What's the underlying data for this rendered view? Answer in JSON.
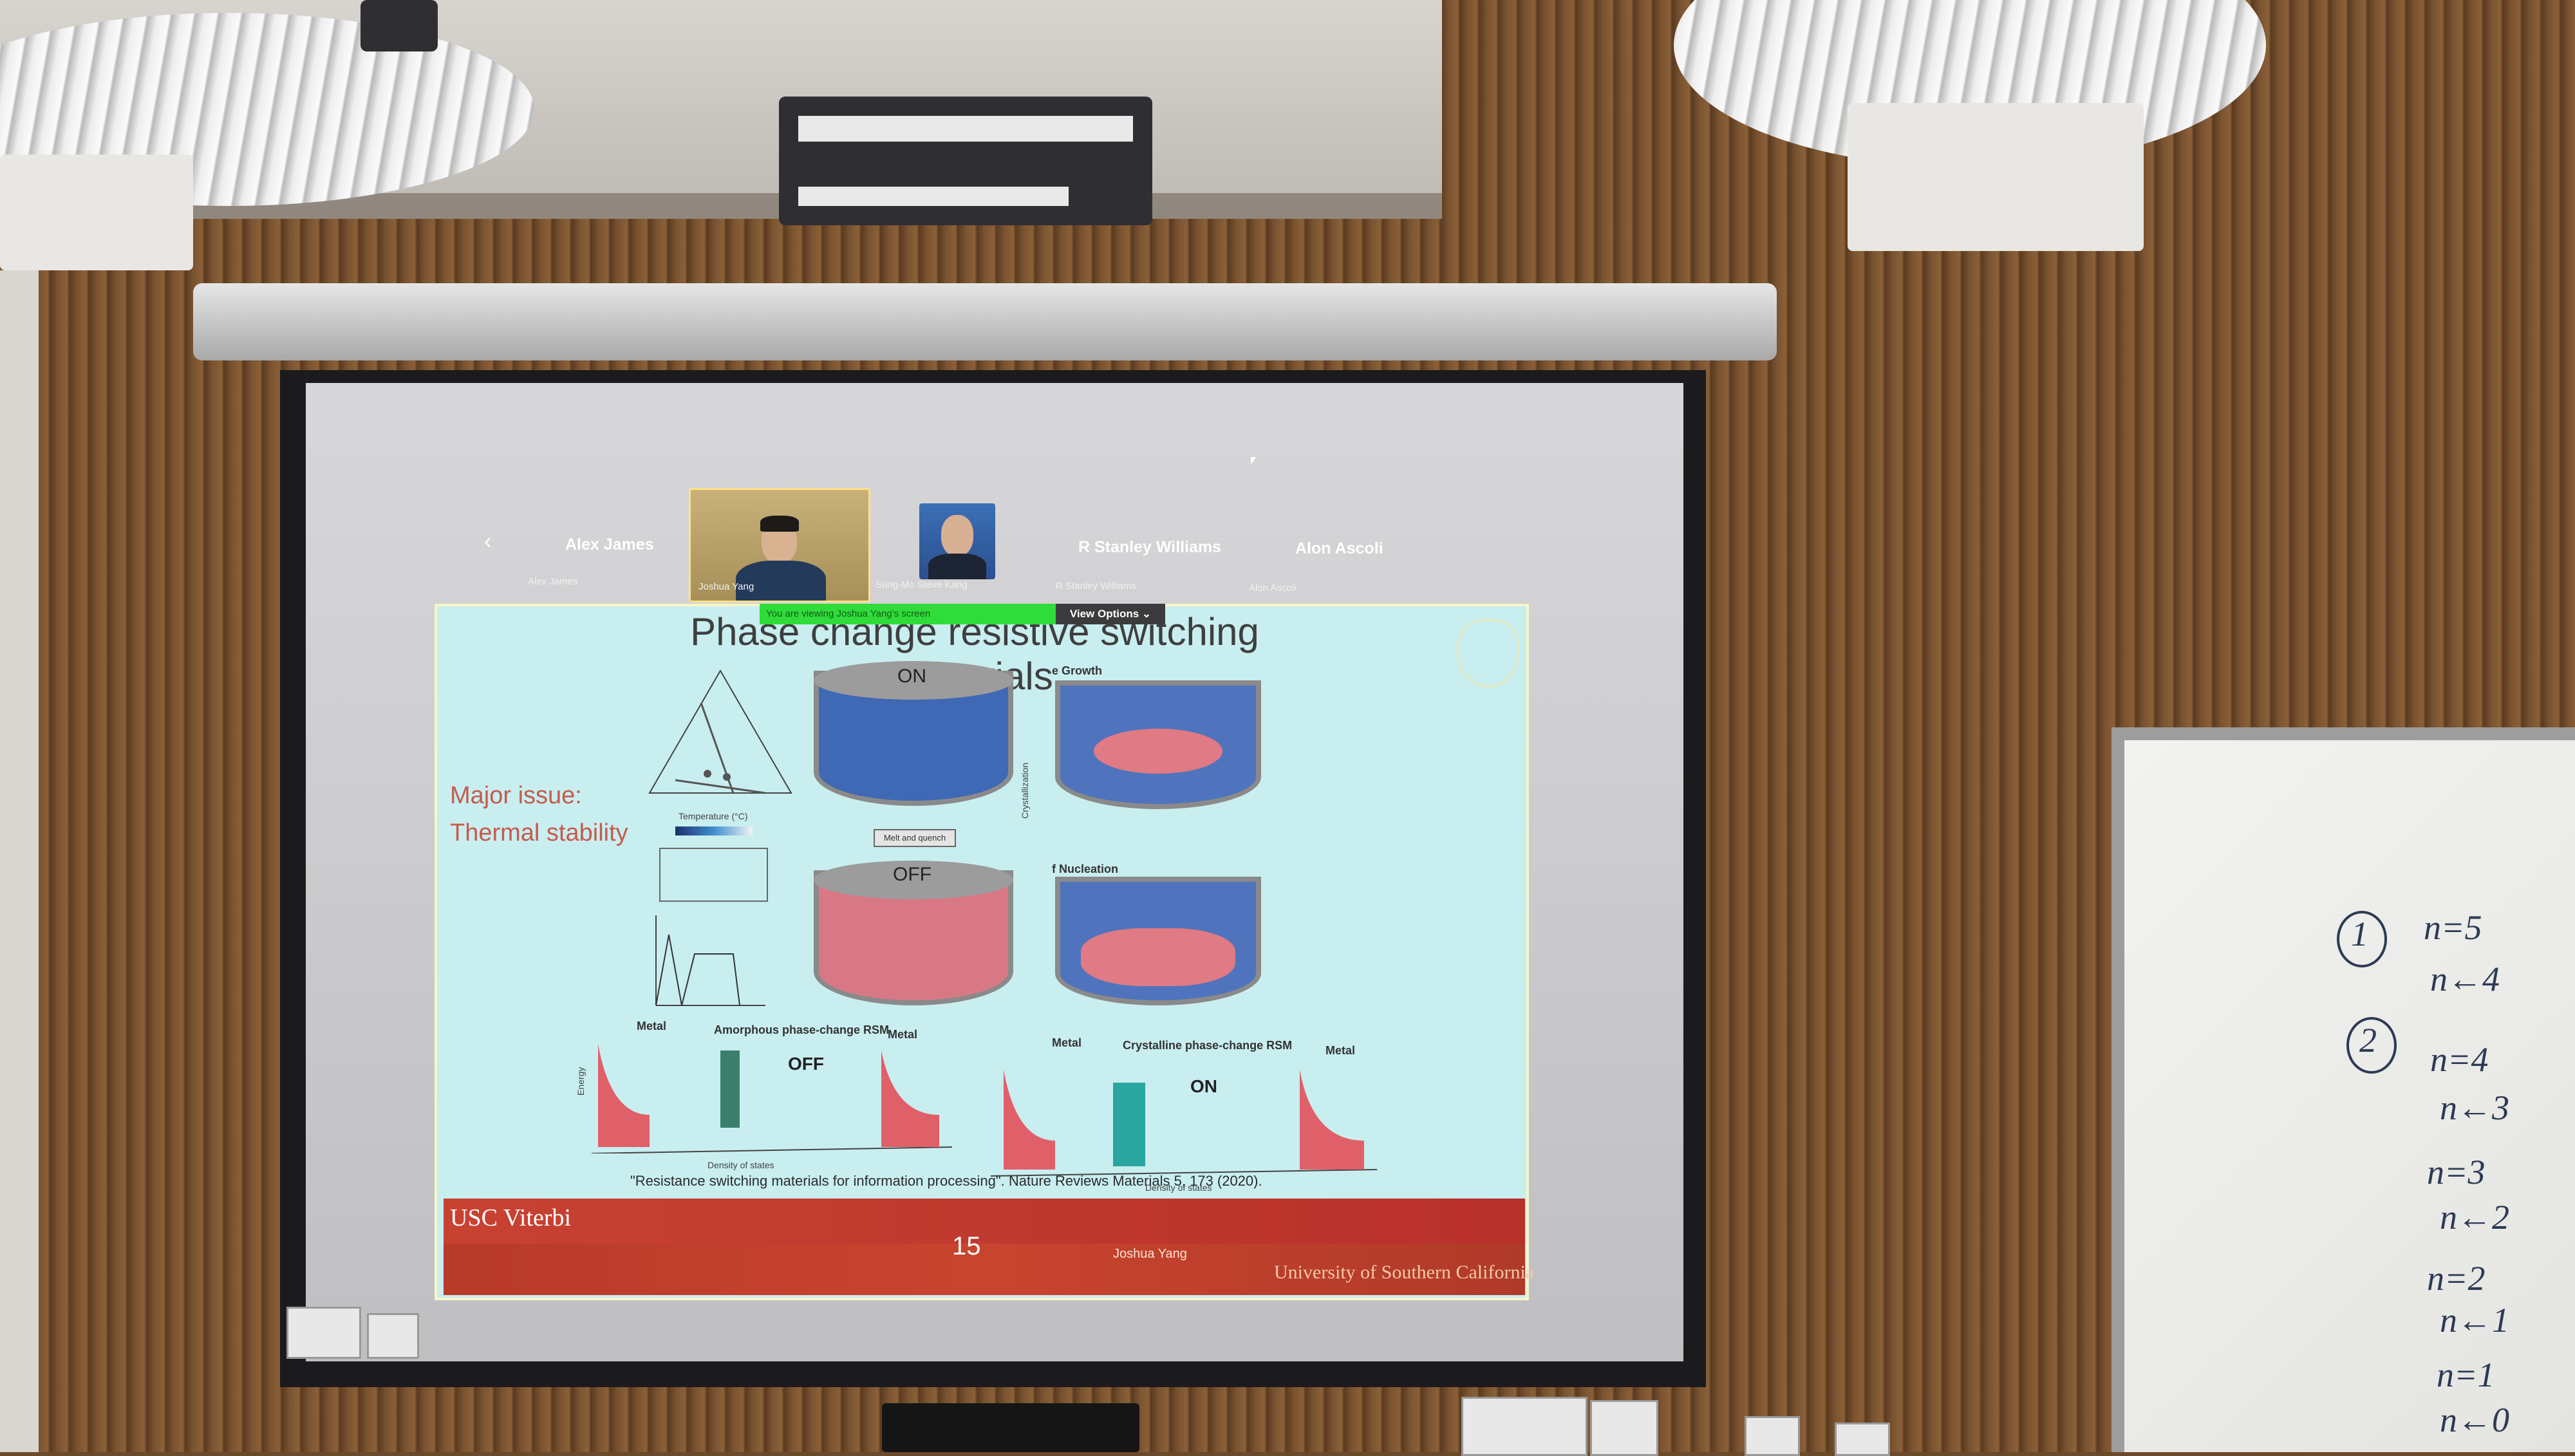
{
  "zoom": {
    "participants": [
      {
        "name": "Alex James",
        "sub": "Alex James"
      },
      {
        "name": "",
        "sub": "Joshua Yang"
      },
      {
        "name": "",
        "sub": "Sung-Mo Steve Kang"
      },
      {
        "name": "R Stanley Williams",
        "sub": "R Stanley Williams"
      },
      {
        "name": "Alon Ascoli",
        "sub": "Alon Ascoli"
      }
    ],
    "share_notice": "You are viewing Joshua Yang's screen",
    "view_options": "View Options"
  },
  "slide": {
    "title": "Phase change resistive switching materials",
    "issue_line1": "Major issue:",
    "issue_line2": "Thermal stability",
    "on_label": "ON",
    "off_label": "OFF",
    "melt_label": "Melt and quench",
    "crystallization": "Crystallization",
    "growth": "e Growth",
    "nucleation": "f Nucleation",
    "temperature_label": "Temperature (°C)",
    "amorphous_label": "Amorphous phase-change RSM",
    "crystalline_label": "Crystalline phase-change RSM",
    "metal": "Metal",
    "density": "Density of states",
    "energy": "Energy",
    "citation": "\"Resistance switching materials for information processing\". Nature Reviews Materials 5, 173 (2020).",
    "usc": "USC Viterbi",
    "page": "15",
    "speaker": "Joshua Yang",
    "university": "University of Southern California"
  },
  "whiteboard": {
    "n1": "1",
    "l1a": "n=5",
    "l1b": "n←4",
    "n2": "2",
    "l2a": "n=4",
    "l2b": "n←3",
    "l3a": "n=3",
    "l3b": "n←2",
    "l4a": "n=2",
    "l4b": "n←1",
    "l5a": "n=1",
    "l5b": "n←0"
  },
  "colors": {
    "slide_bg": "#c9eef0",
    "accent_red": "#c84232",
    "share_green": "#2fdc3a"
  }
}
